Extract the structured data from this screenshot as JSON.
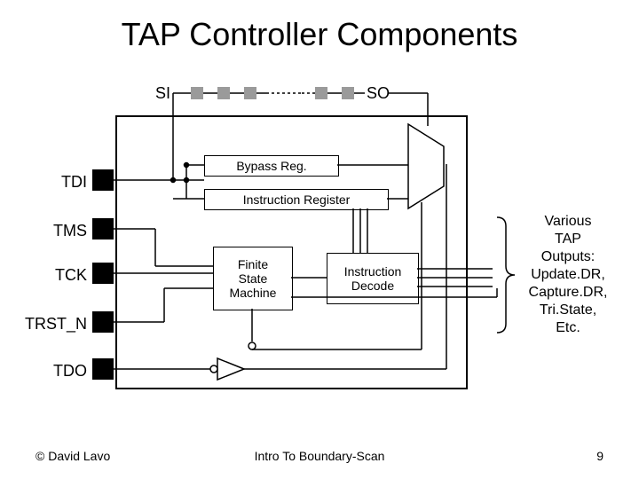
{
  "title": "TAP Controller Components",
  "signals": {
    "si": "SI",
    "so": "SO",
    "tdi": "TDI",
    "tms": "TMS",
    "tck": "TCK",
    "trstn": "TRST_N",
    "tdo": "TDO"
  },
  "blocks": {
    "bypass": "Bypass Reg.",
    "ir": "Instruction Register",
    "fsm_l1": "Finite",
    "fsm_l2": "State",
    "fsm_l3": "Machine",
    "idec_l1": "Instruction",
    "idec_l2": "Decode"
  },
  "side": {
    "l1": "Various",
    "l2": "TAP",
    "l3": "Outputs:",
    "l4": "Update.DR,",
    "l5": "Capture.DR,",
    "l6": "Tri.State,",
    "l7": "Etc."
  },
  "footer": {
    "left": "© David Lavo",
    "center": "Intro To Boundary-Scan",
    "right": "9"
  }
}
